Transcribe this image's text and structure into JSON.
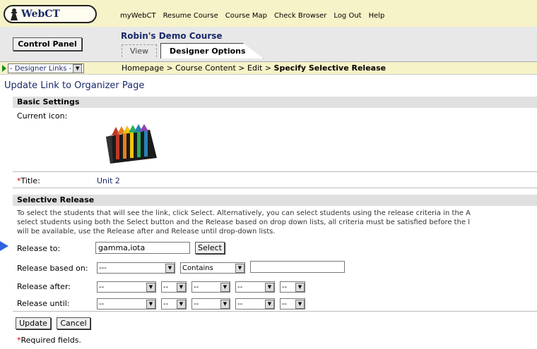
{
  "header": {
    "logo_text": "WebCT",
    "nav": [
      "myWebCT",
      "Resume Course",
      "Course Map",
      "Check Browser",
      "Log Out",
      "Help"
    ]
  },
  "course": {
    "control_panel_label": "Control Panel",
    "title": "Robin's Demo Course",
    "tabs": {
      "view": "View",
      "designer": "Designer Options"
    }
  },
  "breadcrumb": {
    "designer_links": "- Designer Links -",
    "path": "Homepage > Course Content > Edit > ",
    "current": "Specify Selective Release"
  },
  "page": {
    "title": "Update Link to Organizer Page",
    "basic_settings": "Basic Settings",
    "current_icon_label": "Current icon:",
    "title_label": "Title:",
    "title_value": "Unit 2",
    "required_mark": "*"
  },
  "selective": {
    "heading": "Selective Release",
    "instructions": [
      "To select the students that will see the link, click Select. Alternatively, you can select students using the release criteria in the A",
      "select students using both the Select button and the Release based on drop down lists, all criteria must be satisfied before the l",
      "will be available, use the Release after and Release until drop-down lists."
    ],
    "release_to_label": "Release to:",
    "release_to_value": "gamma,iota",
    "select_button": "Select",
    "release_based_label": "Release based on:",
    "release_based_value": "---",
    "contains_value": "Contains",
    "contains_input": "",
    "release_after_label": "Release after:",
    "release_until_label": "Release until:",
    "date_placeholder": "--"
  },
  "footer": {
    "update_button": "Update",
    "cancel_button": "Cancel",
    "required_note": "Required fields."
  },
  "colors": {
    "link_blue": "#1a2a6a",
    "header_bg": "#f7f3c8",
    "required_red": "#cc0000"
  }
}
